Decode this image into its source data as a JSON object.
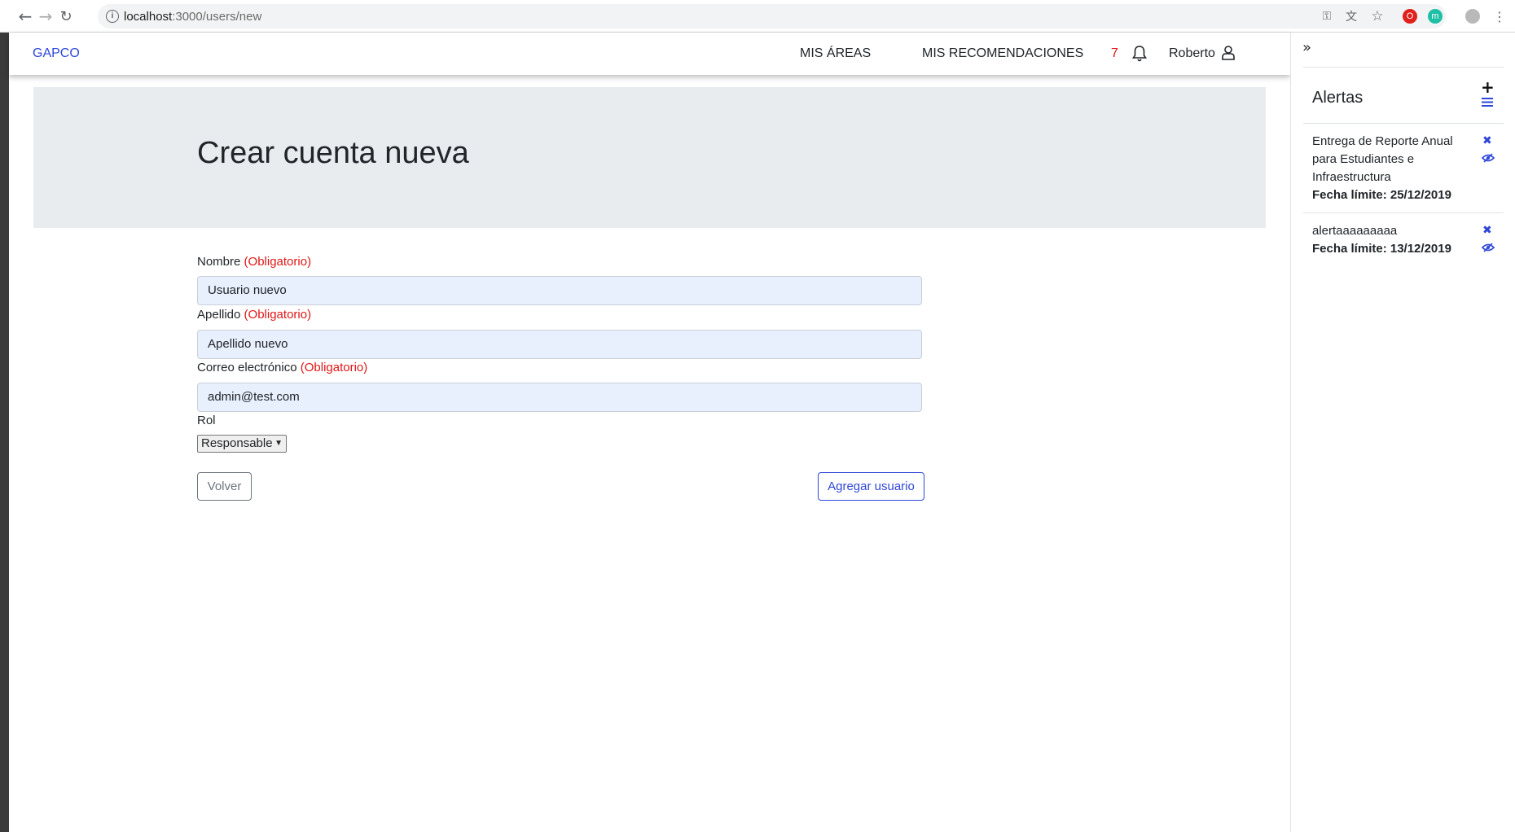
{
  "browser": {
    "url_host": "localhost",
    "url_path": ":3000/users/new"
  },
  "navbar": {
    "brand": "GAPCO",
    "links": [
      "MIS ÁREAS",
      "MIS RECOMENDACIONES"
    ],
    "notification_count": "7",
    "user_name": "Roberto"
  },
  "header": {
    "title": "Crear cuenta nueva"
  },
  "form": {
    "fields": [
      {
        "label": "Nombre",
        "required": "(Obligatorio)",
        "value": "Usuario nuevo"
      },
      {
        "label": "Apellido",
        "required": "(Obligatorio)",
        "value": "Apellido nuevo"
      },
      {
        "label": "Correo electrónico",
        "required": "(Obligatorio)",
        "value": "admin@test.com"
      }
    ],
    "role_label": "Rol",
    "role_value": "Responsable",
    "back_label": "Volver",
    "submit_label": "Agregar usuario"
  },
  "alerts_panel": {
    "title": "Alertas",
    "items": [
      {
        "text": "Entrega de Reporte Anual para Estudiantes e Infraestructura",
        "due": "Fecha límite: 25/12/2019"
      },
      {
        "text": "alertaaaaaaaaa",
        "due": "Fecha límite: 13/12/2019"
      }
    ]
  },
  "colors": {
    "accent": "#2f47d8",
    "required": "#e01616",
    "jumbotron": "#e9ecef",
    "autofill": "#e8f0fe"
  }
}
